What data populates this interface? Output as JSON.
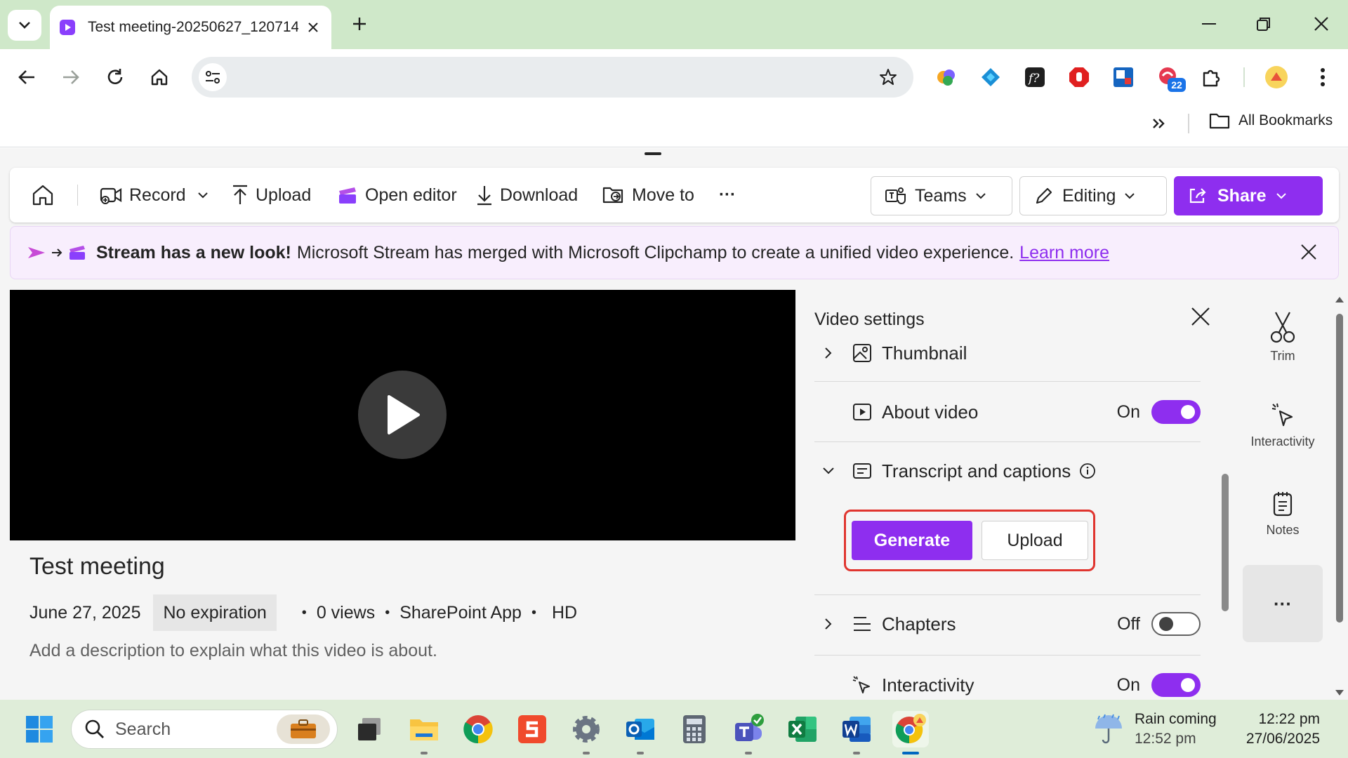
{
  "browser": {
    "tab_title": "Test meeting-20250627_120714",
    "bookmarks": {
      "folder_label": "All Bookmarks"
    },
    "extension_badge": "22"
  },
  "page": {
    "command_bar": {
      "record": "Record",
      "upload": "Upload",
      "open_editor": "Open editor",
      "download": "Download",
      "move_to": "Move to",
      "more": "···",
      "teams": "Teams",
      "editing": "Editing",
      "share": "Share"
    },
    "banner": {
      "bold": "Stream has a new look!",
      "text": "Microsoft Stream has merged with Microsoft Clipchamp to create a unified video experience.",
      "link": "Learn more"
    },
    "video": {
      "title": "Test meeting",
      "date": "June 27, 2025",
      "expiration": "No expiration",
      "views": "0 views",
      "source": "SharePoint App",
      "quality": "HD",
      "description_placeholder": "Add a description to explain what this video is about."
    },
    "settings": {
      "title": "Video settings",
      "thumbnail": "Thumbnail",
      "about_video": {
        "label": "About video",
        "state": "On"
      },
      "transcript": {
        "label": "Transcript and captions",
        "generate": "Generate",
        "upload": "Upload"
      },
      "chapters": {
        "label": "Chapters",
        "state": "Off"
      },
      "interactivity": {
        "label": "Interactivity",
        "state": "On"
      }
    },
    "rail": {
      "trim": "Trim",
      "interactivity": "Interactivity",
      "notes": "Notes",
      "more": "···"
    }
  },
  "taskbar": {
    "search_placeholder": "Search",
    "weather": {
      "line1": "Rain coming",
      "line2": "12:52 pm"
    },
    "clock": {
      "time": "12:22 pm",
      "date": "27/06/2025"
    }
  },
  "colors": {
    "accent": "#8e2eef",
    "tabstrip": "#cfe8c9",
    "highlight_box": "#e0352f"
  }
}
